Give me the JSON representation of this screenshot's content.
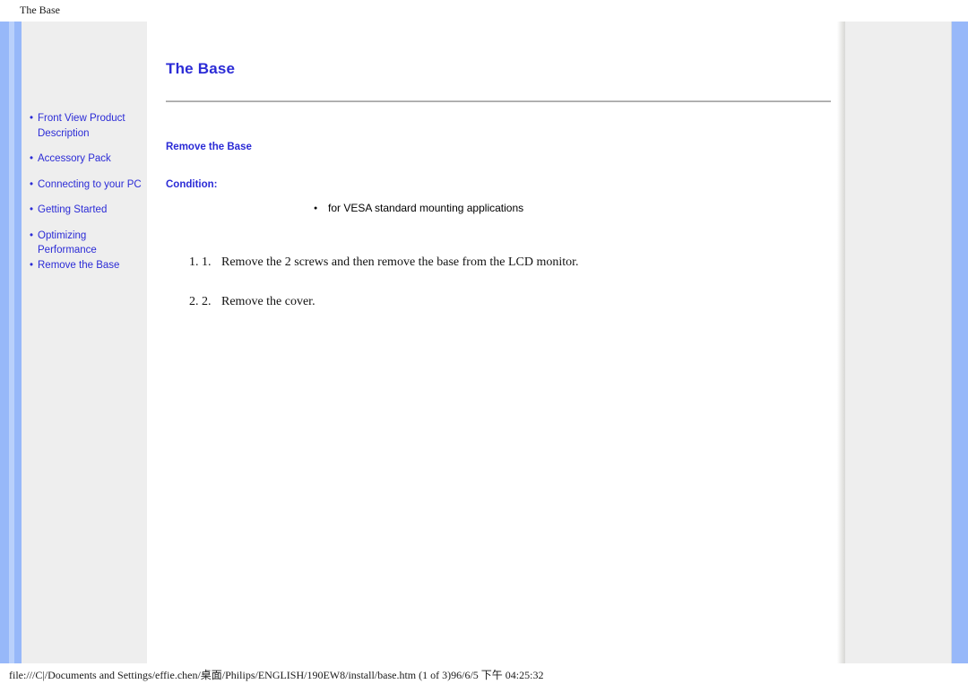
{
  "browser": {
    "header_title": "The Base",
    "footer_status": "file:///C|/Documents and Settings/effie.chen/桌面/Philips/ENGLISH/190EW8/install/base.htm (1 of 3)96/6/5 下午 04:25:32"
  },
  "theme": {
    "link_blue": "#2b2bd6",
    "band_blue": "#97b8f9",
    "band_blue_light": "#b9d0fb",
    "sidebar_gray": "#eeeeee",
    "rule_gray": "#a8a8a8"
  },
  "sidebar": {
    "bullet": "•",
    "items": [
      {
        "label": "Front View Product Description"
      },
      {
        "label": "Accessory Pack"
      },
      {
        "label": "Connecting to your PC"
      },
      {
        "label": "Getting Started"
      },
      {
        "label": "Optimizing Performance"
      },
      {
        "label": "Remove the Base"
      }
    ]
  },
  "main": {
    "title": "The Base",
    "section_heading": "Remove the Base",
    "condition_heading": "Condition:",
    "conditions": [
      "for VESA standard mounting applications"
    ],
    "steps": [
      {
        "number": "1.",
        "text": "Remove the 2 screws and then remove the base from the LCD monitor."
      },
      {
        "number": "2.",
        "text": "Remove the cover."
      }
    ]
  }
}
